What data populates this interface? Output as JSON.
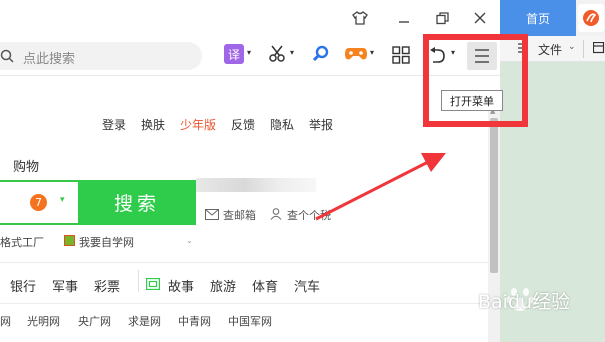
{
  "side_panel": {
    "tab_home": "首页",
    "file_menu": "文件"
  },
  "toolbar": {
    "search_placeholder": "点此搜索",
    "translate_label": "译"
  },
  "tooltip": "打开菜单",
  "top_links": [
    "登录",
    "换肤",
    "少年版",
    "反馈",
    "隐私",
    "举报"
  ],
  "shopping_label": "购物",
  "search": {
    "badge": "7",
    "button_label": "搜索"
  },
  "side_links": {
    "mail": "查邮箱",
    "tax": "查个个税"
  },
  "quick_links": {
    "left_text": "格式工厂",
    "self_study": "我要自学网"
  },
  "nav": {
    "items": [
      "银行",
      "军事",
      "彩票",
      "故事",
      "旅游",
      "体育",
      "汽车"
    ]
  },
  "media_links": [
    "网",
    "光明网",
    "央广网",
    "求是网",
    "中青网",
    "中国军网"
  ],
  "watermark": "Baidu经验"
}
